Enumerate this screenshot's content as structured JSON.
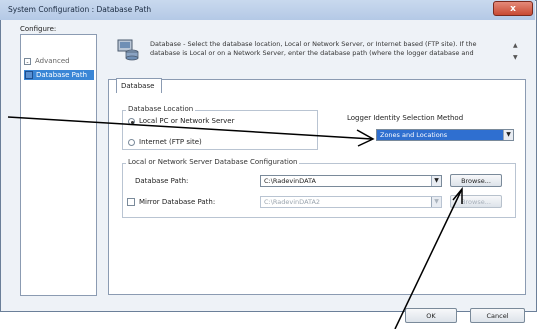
{
  "window": {
    "title": "System Configuration : Database Path",
    "close_glyph": "x"
  },
  "sidebar": {
    "header": "Configure:",
    "items": [
      {
        "label": "Advanced",
        "expander": "-"
      },
      {
        "label": "Database Path"
      }
    ]
  },
  "description": {
    "icon": "database-config-icon",
    "text_line1": "Database - Select the database location, Local or Network Server, or Internet based (FTP site). If the",
    "text_line2": "database is Local or on a Network Server, enter the database path (where the logger database and"
  },
  "tabs": [
    {
      "label": "Database"
    }
  ],
  "database_location": {
    "title": "Database Location",
    "options": [
      {
        "label": "Local PC or Network Server",
        "selected": true
      },
      {
        "label": "Internet (FTP site)",
        "selected": false
      }
    ]
  },
  "logger_identity": {
    "label": "Logger Identity Selection Method",
    "value": "Zones and Locations"
  },
  "server_config": {
    "title": "Local or Network Server Database Configuration",
    "db_path_label": "Database Path:",
    "db_path_value": "C:\\RadevinDATA",
    "browse_label": "Browse...",
    "mirror_label": "Mirror Database Path:",
    "mirror_value": "C:\\RadevinDATA2",
    "mirror_browse_label": "Browse..."
  },
  "footer": {
    "ok_label": "OK",
    "cancel_label": "Cancel"
  },
  "colors": {
    "selection": "#2f6fd0",
    "arrow": "#000000",
    "close": "#c84a33"
  }
}
